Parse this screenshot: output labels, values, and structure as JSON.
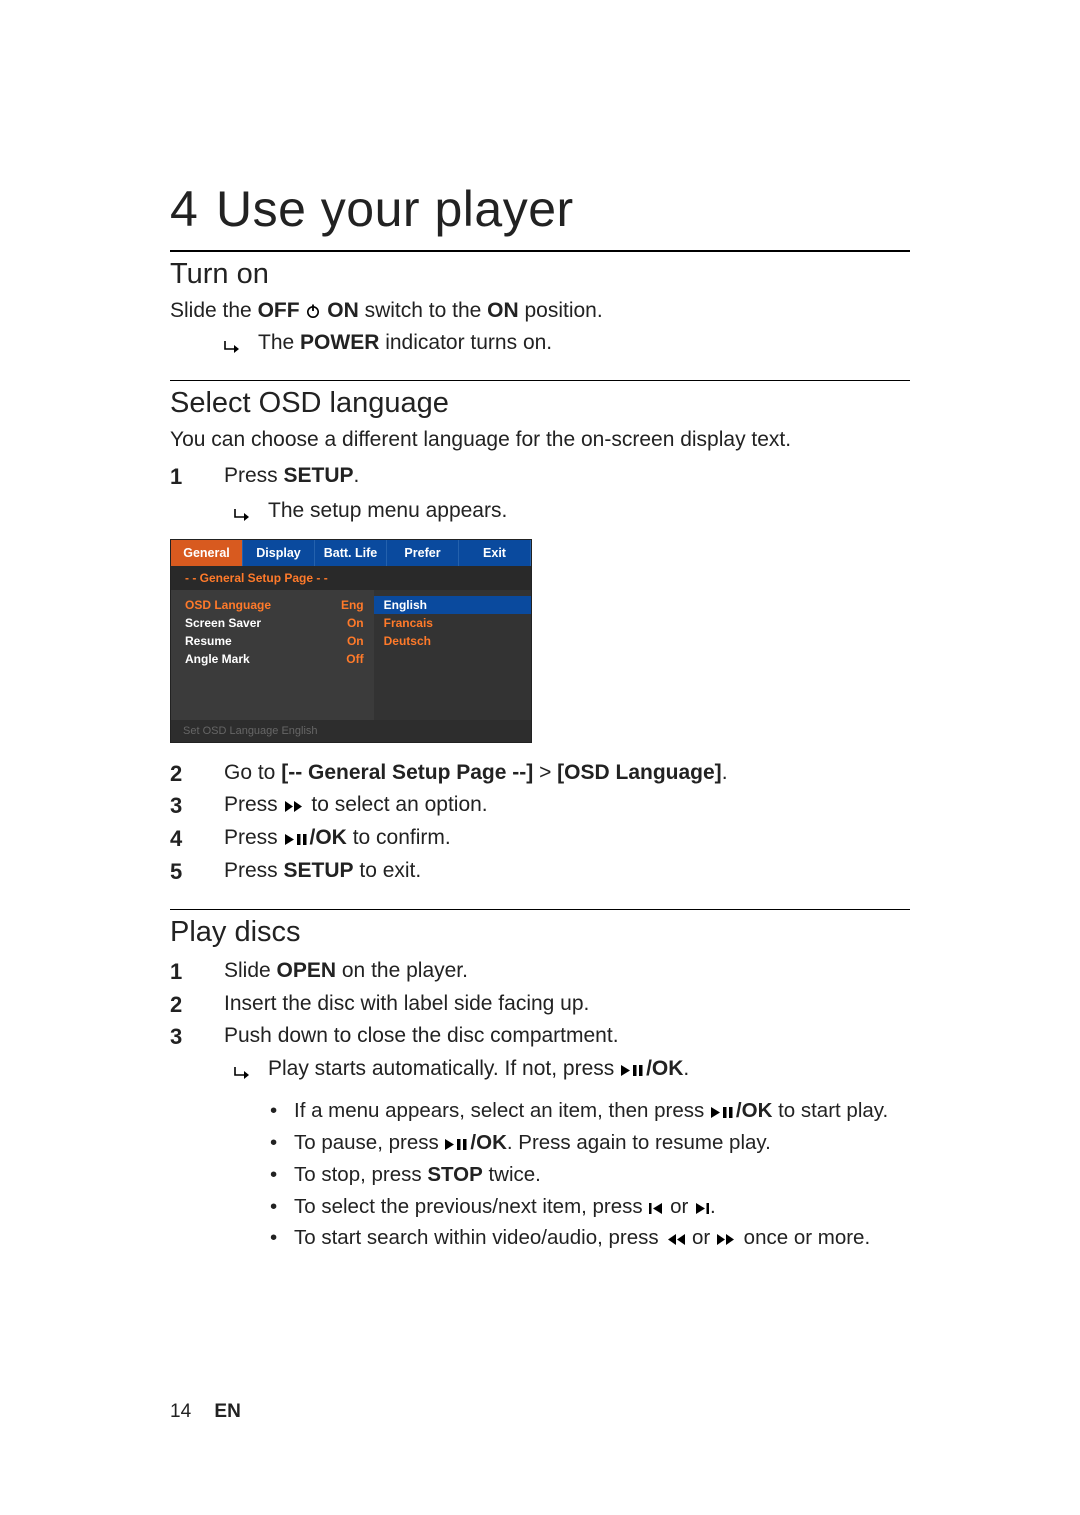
{
  "chapter": {
    "number": "4",
    "title": "Use your player"
  },
  "sections": {
    "turn_on": {
      "title": "Turn on",
      "line1_pre": "Slide the ",
      "off_label": "OFF",
      "on_label": "ON",
      "line1_mid": " switch to the ",
      "on_label2": "ON",
      "line1_post": " position.",
      "result_pre": " The ",
      "power_label": "POWER",
      "result_post": " indicator turns on."
    },
    "osd": {
      "title": "Select OSD language",
      "intro": "You can choose a different language for the on-screen display text.",
      "steps": {
        "s1_pre": "Press ",
        "s1_key": "SETUP",
        "s1_post": ".",
        "s1_result": " The setup menu appears.",
        "s2_pre": "Go to ",
        "s2_path1": "[-- General Setup Page --]",
        "s2_sep": " > ",
        "s2_path2": "[OSD Language]",
        "s2_post": ".",
        "s3_pre": "Press ",
        "s3_post": " to select an option.",
        "s4_pre": "Press ",
        "s4_key": "/OK",
        "s4_post": " to confirm.",
        "s5_pre": "Press ",
        "s5_key": "SETUP",
        "s5_post": " to exit."
      }
    },
    "play": {
      "title": "Play discs",
      "s1_pre": "Slide ",
      "s1_key": "OPEN",
      "s1_post": " on the player.",
      "s2": "Insert the disc with label side facing up.",
      "s3": "Push down to close the disc compartment.",
      "s3_result_pre": " Play starts automatically. If not, press ",
      "s3_result_key": "/OK",
      "s3_result_post": ".",
      "b1_pre": "If a menu appears, select an item, then press ",
      "b1_key": "/OK",
      "b1_post": " to start play.",
      "b2_pre": "To pause, press ",
      "b2_key": "/OK",
      "b2_post": ". Press again to resume play.",
      "b3_pre": "To stop, press ",
      "b3_key": "STOP",
      "b3_post": " twice.",
      "b4_pre": "To select the previous/next item, press ",
      "b4_mid": " or ",
      "b4_post": ".",
      "b5_pre": "To start search within video/audio, press ",
      "b5_mid": " or ",
      "b5_post": " once or more."
    }
  },
  "osd_menu": {
    "tabs": [
      "General",
      "Display",
      "Batt. Life",
      "Prefer",
      "Exit"
    ],
    "subhead": "- -   General Setup Page   - -",
    "left_rows": [
      {
        "label": "OSD  Language",
        "value": "Eng",
        "selected": true
      },
      {
        "label": "Screen Saver",
        "value": "On",
        "selected": false
      },
      {
        "label": "Resume",
        "value": "On",
        "selected": false
      },
      {
        "label": "Angle Mark",
        "value": "Off",
        "selected": false
      }
    ],
    "right_rows": [
      {
        "label": "English",
        "selected": true
      },
      {
        "label": "Francais",
        "selected": false
      },
      {
        "label": "Deutsch",
        "selected": false
      }
    ],
    "hint": "Set OSD Language English"
  },
  "footer": {
    "page_number": "14",
    "lang": "EN"
  }
}
